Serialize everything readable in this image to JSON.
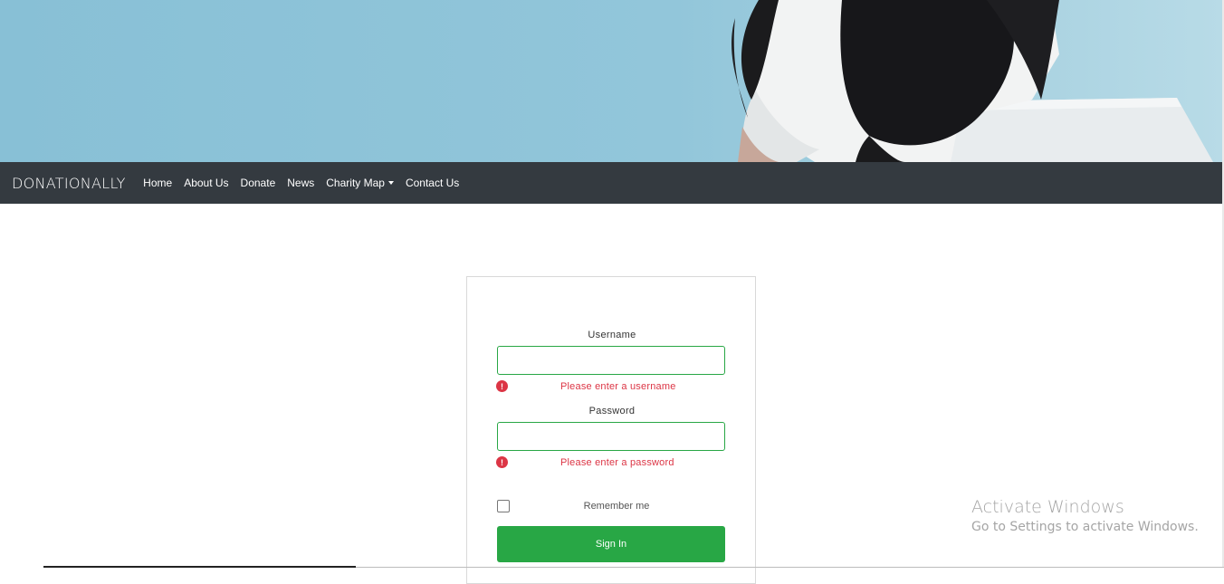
{
  "navbar": {
    "brand": "DONATIONALLY",
    "links": [
      "Home",
      "About Us",
      "Donate",
      "News",
      "Charity Map",
      "Contact Us"
    ]
  },
  "login": {
    "username_label": "Username",
    "username_value": "",
    "username_error": "Please enter a username",
    "password_label": "Password",
    "password_value": "",
    "password_error": "Please enter a password",
    "remember_label": "Remember me",
    "remember_checked": false,
    "signin_label": "Sign In"
  },
  "watermark": {
    "title": "Activate Windows",
    "subtitle": "Go to Settings to activate Windows."
  },
  "colors": {
    "navbar": "#343a40",
    "accent": "#28a745",
    "error": "#dc3545",
    "hero": "#92c6da"
  }
}
